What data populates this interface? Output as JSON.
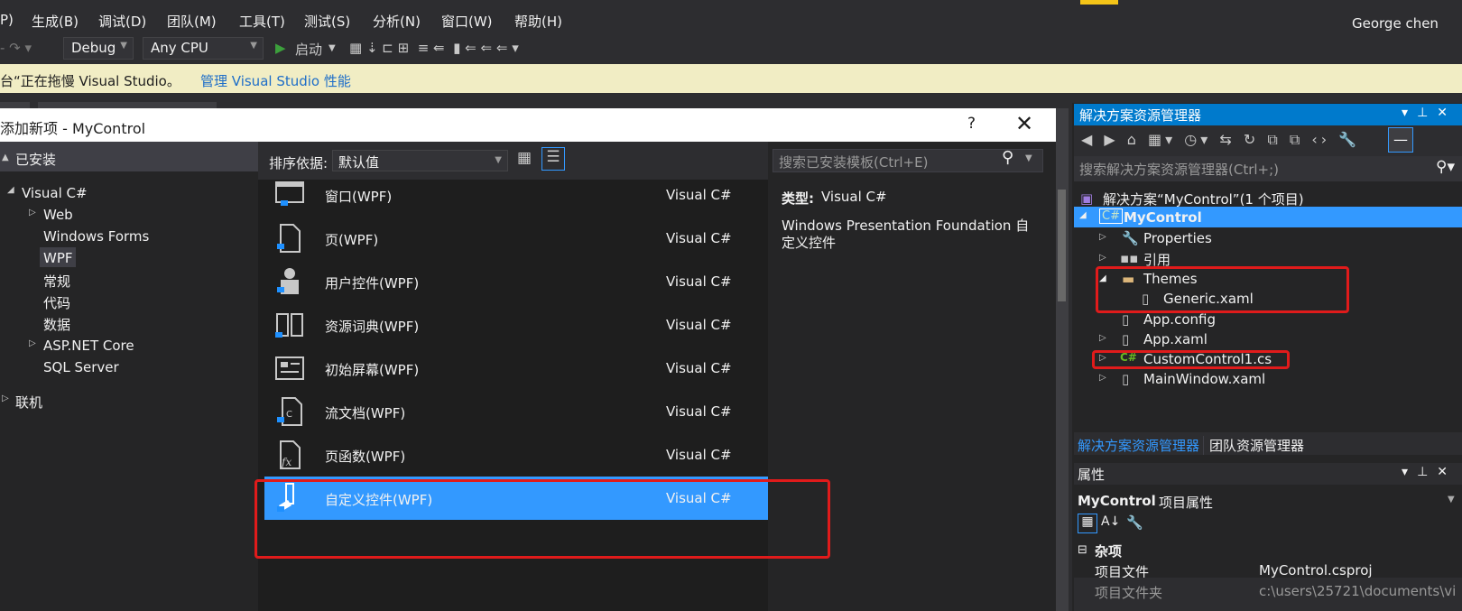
{
  "menu": [
    "P)",
    "生成(B)",
    "调试(D)",
    "团队(M)",
    "工具(T)",
    "测试(S)",
    "分析(N)",
    "窗口(W)",
    "帮助(H)"
  ],
  "user": "George chen",
  "toolbar": {
    "config": "Debug",
    "platform": "Any CPU",
    "start": "启动"
  },
  "infobar": {
    "message": "台“正在拖慢 Visual Studio。",
    "link": "管理 Visual Studio 性能"
  },
  "dialog": {
    "title": "添加新项 - MyControl",
    "help": "?",
    "close": "✕",
    "tree": {
      "installed": "已安装",
      "visual_csharp": "Visual C#",
      "web": "Web",
      "windows_forms": "Windows Forms",
      "wpf": "WPF",
      "general": "常规",
      "code": "代码",
      "data": "数据",
      "aspnet_core": "ASP.NET Core",
      "sql_server": "SQL Server",
      "online": "联机"
    },
    "sort_label": "排序依据:",
    "sort_value": "默认值",
    "search_placeholder": "搜索已安装模板(Ctrl+E)",
    "templates": [
      {
        "name": "窗口(WPF)",
        "lang": "Visual C#"
      },
      {
        "name": "页(WPF)",
        "lang": "Visual C#"
      },
      {
        "name": "用户控件(WPF)",
        "lang": "Visual C#"
      },
      {
        "name": "资源词典(WPF)",
        "lang": "Visual C#"
      },
      {
        "name": "初始屏幕(WPF)",
        "lang": "Visual C#"
      },
      {
        "name": "流文档(WPF)",
        "lang": "Visual C#"
      },
      {
        "name": "页函数(WPF)",
        "lang": "Visual C#"
      },
      {
        "name": "自定义控件(WPF)",
        "lang": "Visual C#"
      }
    ],
    "selected_index": 7,
    "desc_type_label": "类型:",
    "desc_type_value": "Visual C#",
    "desc_line1": "Windows Presentation Foundation 自",
    "desc_line2": "定义控件"
  },
  "solution_explorer": {
    "title": "解决方案资源管理器",
    "search_placeholder": "搜索解决方案资源管理器(Ctrl+;)",
    "solution": "解决方案“MyControl”(1 个项目)",
    "project": "MyControl",
    "items": {
      "properties": "Properties",
      "references": "引用",
      "themes": "Themes",
      "generic": "Generic.xaml",
      "app_config": "App.config",
      "app_xaml": "App.xaml",
      "custom_control": "CustomControl1.cs",
      "main_window": "MainWindow.xaml"
    },
    "tab_active": "解决方案资源管理器",
    "tab_team": "团队资源管理器"
  },
  "properties": {
    "title": "属性",
    "object": "MyControl",
    "object_suffix": "项目属性",
    "category": "杂项",
    "rows": [
      {
        "name": "项目文件",
        "value": "MyControl.csproj"
      },
      {
        "name": "项目文件夹",
        "value": "c:\\users\\25721\\documents\\vi"
      }
    ]
  },
  "colors": {
    "accent": "#007acc",
    "selection": "#3399ff",
    "annotation": "#e01b1b",
    "infobar": "#f1edc4"
  }
}
